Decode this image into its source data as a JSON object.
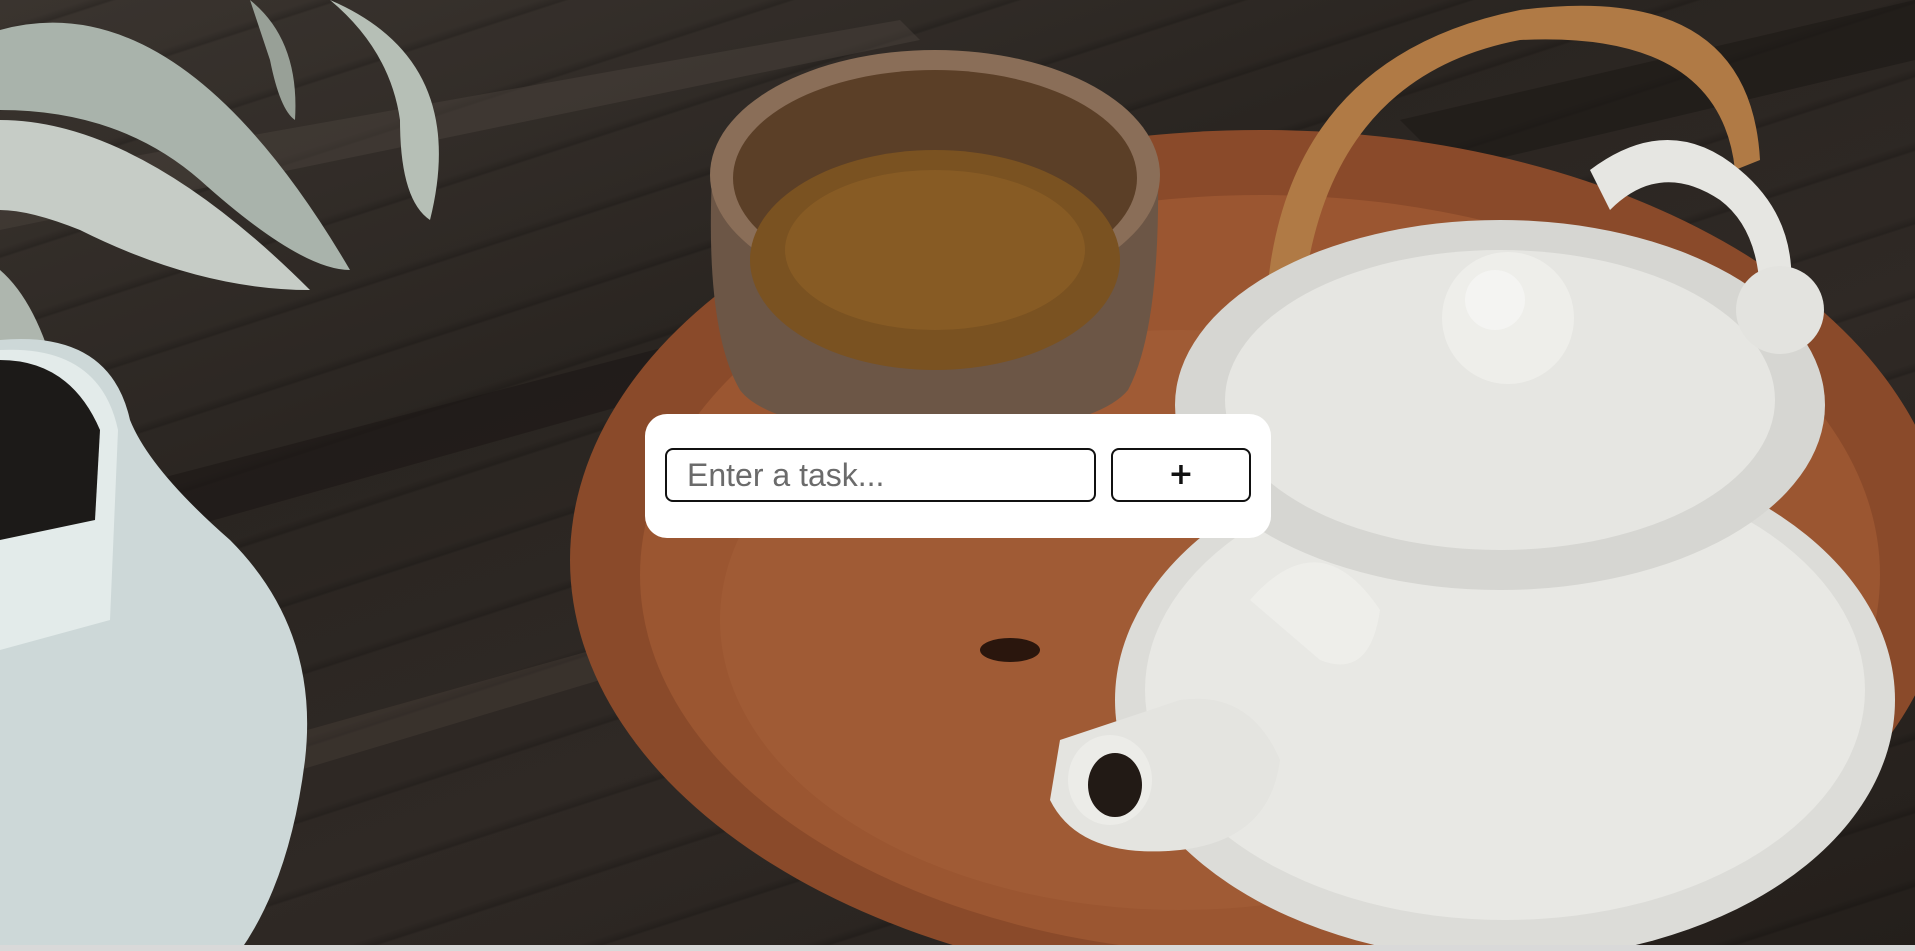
{
  "task_form": {
    "input_placeholder": "Enter a task...",
    "input_value": "",
    "add_button_label": "+"
  }
}
